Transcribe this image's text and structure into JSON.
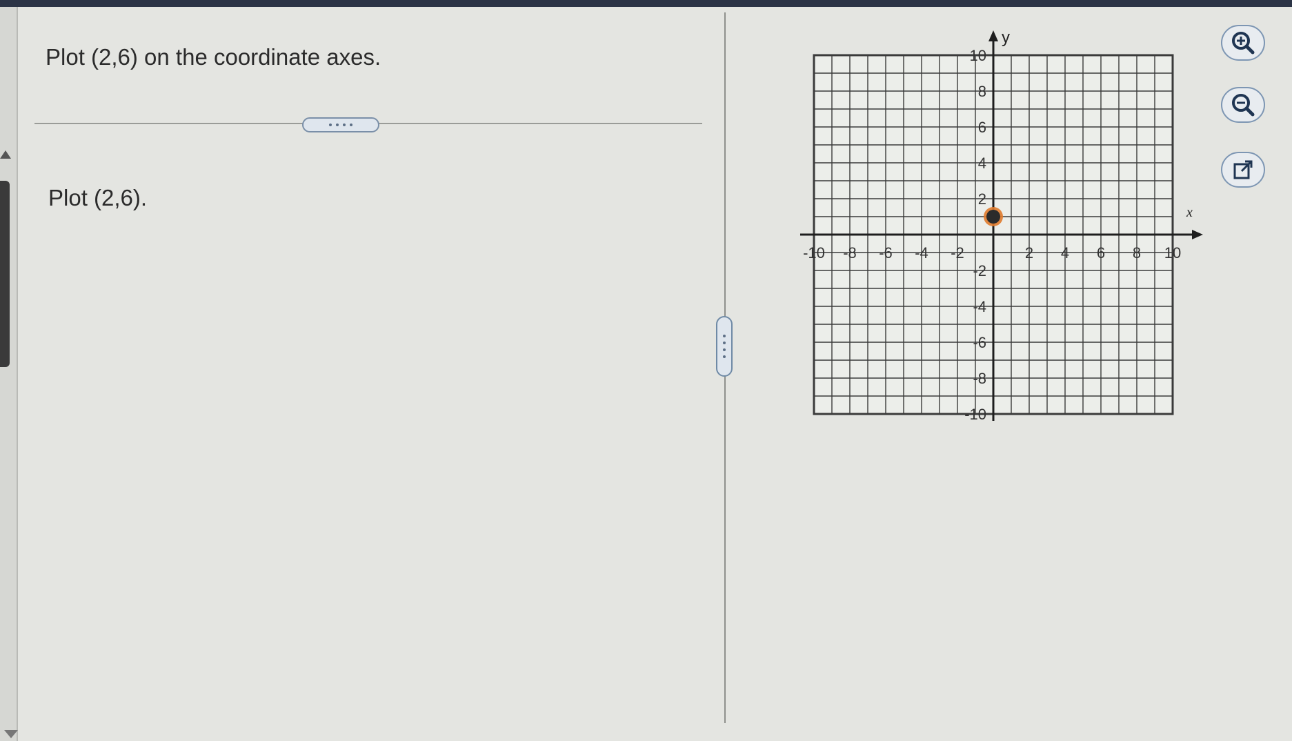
{
  "question": {
    "text": "Plot (2,6) on the coordinate axes."
  },
  "instruction": {
    "text": "Plot (2,6)."
  },
  "graph": {
    "x_axis_label": "x",
    "y_axis_label": "y",
    "x_range": [
      -10,
      10
    ],
    "y_range": [
      -10,
      10
    ],
    "grid_step": 1,
    "x_tick_labels": [
      "-10",
      "-8",
      "-6",
      "-4",
      "-2",
      "2",
      "4",
      "6",
      "8",
      "10"
    ],
    "y_tick_labels": [
      "10",
      "8",
      "6",
      "4",
      "2",
      "-2",
      "-4",
      "-6",
      "-8",
      "-10"
    ],
    "plotted_point": {
      "x": 0,
      "y": 1
    },
    "point_color": "#2b2b2b",
    "point_ring_color": "#e07a2c",
    "grid_color": "#3a3a3a"
  },
  "toolbar": {
    "zoom_in_icon": "zoom-in-icon",
    "zoom_out_icon": "zoom-out-icon",
    "popout_icon": "external-link-icon"
  },
  "colors": {
    "accent": "#6f8aa6",
    "background": "#e4e5e1"
  }
}
